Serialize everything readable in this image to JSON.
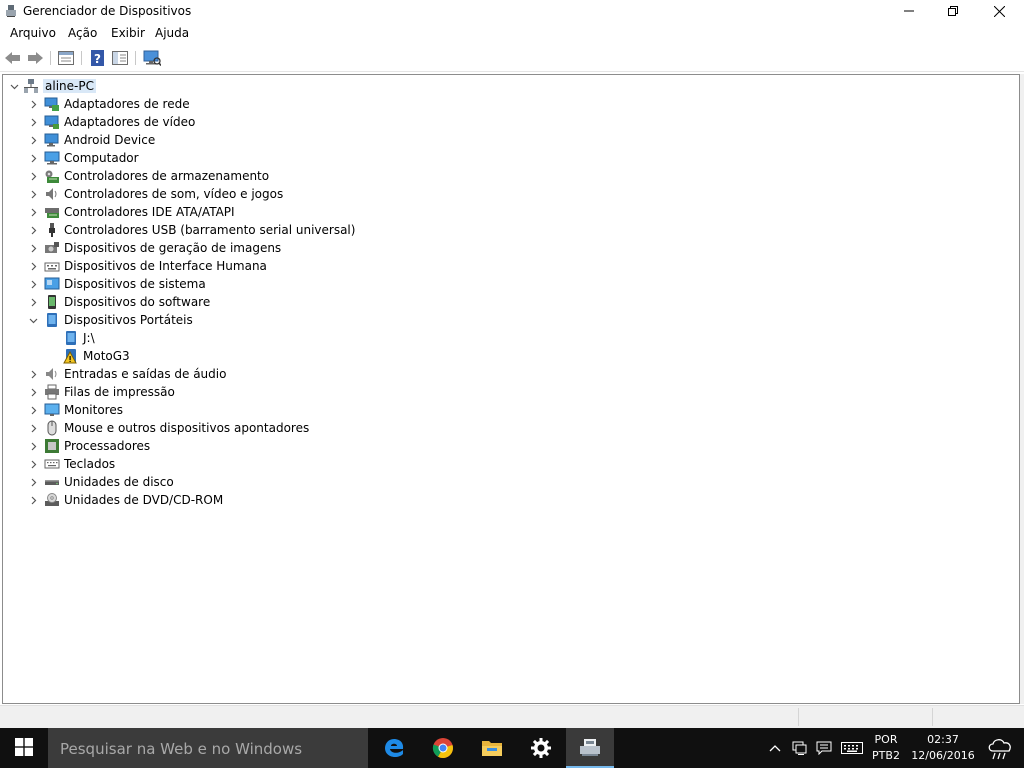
{
  "window": {
    "title": "Gerenciador de Dispositivos",
    "controls": {
      "minimize": "minimize",
      "maximize": "restore",
      "close": "close"
    }
  },
  "menu": {
    "items": [
      "Arquivo",
      "Ação",
      "Exibir",
      "Ajuda"
    ]
  },
  "toolbar": {
    "buttons": [
      "back-arrow",
      "forward-arrow",
      "properties",
      "help",
      "show-hide-console-tree",
      "scan-hardware"
    ]
  },
  "tree": {
    "root": "aline-PC",
    "nodes": [
      {
        "label": "Adaptadores de rede",
        "icon": "network-adapter-icon",
        "expanded": false
      },
      {
        "label": "Adaptadores de vídeo",
        "icon": "display-adapter-icon",
        "expanded": false
      },
      {
        "label": "Android Device",
        "icon": "android-device-icon",
        "expanded": false
      },
      {
        "label": "Computador",
        "icon": "computer-icon",
        "expanded": false
      },
      {
        "label": "Controladores de armazenamento",
        "icon": "storage-controller-icon",
        "expanded": false
      },
      {
        "label": "Controladores de som, vídeo e jogos",
        "icon": "sound-icon",
        "expanded": false
      },
      {
        "label": "Controladores IDE ATA/ATAPI",
        "icon": "ide-controller-icon",
        "expanded": false
      },
      {
        "label": "Controladores USB (barramento serial universal)",
        "icon": "usb-icon",
        "expanded": false
      },
      {
        "label": "Dispositivos de geração de imagens",
        "icon": "imaging-device-icon",
        "expanded": false
      },
      {
        "label": "Dispositivos de Interface Humana",
        "icon": "hid-icon",
        "expanded": false
      },
      {
        "label": "Dispositivos de sistema",
        "icon": "system-device-icon",
        "expanded": false
      },
      {
        "label": "Dispositivos do software",
        "icon": "software-device-icon",
        "expanded": false
      },
      {
        "label": "Dispositivos Portáteis",
        "icon": "portable-device-icon",
        "expanded": true,
        "children": [
          {
            "label": "J:\\",
            "icon": "portable-device-icon",
            "warning": false
          },
          {
            "label": "MotoG3",
            "icon": "warning-icon",
            "warning": true
          }
        ]
      },
      {
        "label": "Entradas e saídas de áudio",
        "icon": "audio-io-icon",
        "expanded": false
      },
      {
        "label": "Filas de impressão",
        "icon": "print-queue-icon",
        "expanded": false
      },
      {
        "label": "Monitores",
        "icon": "monitor-icon",
        "expanded": false
      },
      {
        "label": "Mouse e outros dispositivos apontadores",
        "icon": "mouse-icon",
        "expanded": false
      },
      {
        "label": "Processadores",
        "icon": "processor-icon",
        "expanded": false
      },
      {
        "label": "Teclados",
        "icon": "keyboard-icon",
        "expanded": false
      },
      {
        "label": "Unidades de disco",
        "icon": "disk-drive-icon",
        "expanded": false
      },
      {
        "label": "Unidades de DVD/CD-ROM",
        "icon": "dvd-drive-icon",
        "expanded": false
      }
    ]
  },
  "taskbar": {
    "search_placeholder": "Pesquisar na Web e no Windows",
    "apps": [
      "edge-icon",
      "chrome-icon",
      "file-explorer-icon",
      "settings-icon",
      "device-manager-icon"
    ],
    "tray": {
      "language": "POR",
      "layout": "PTB2",
      "time": "02:37",
      "date": "12/06/2016"
    }
  },
  "colors": {
    "selection": "#d9e8f7",
    "taskbar": "#101010",
    "search_box": "#3b3b3b",
    "accent": "#76b9ed"
  }
}
